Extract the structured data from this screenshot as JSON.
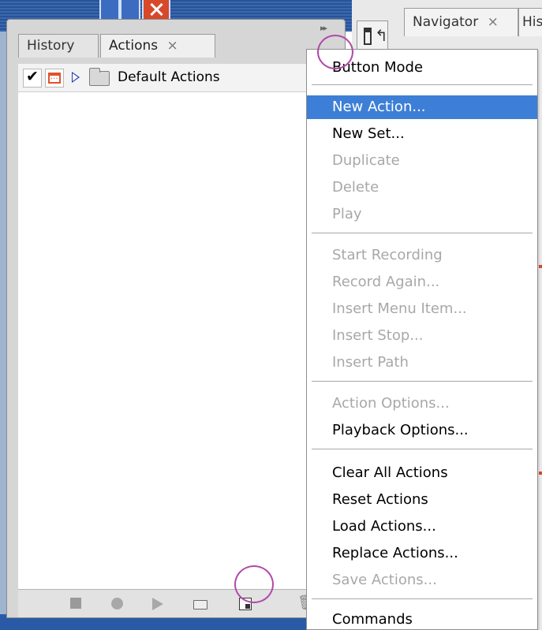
{
  "actions_panel": {
    "tabs": [
      {
        "label": "History"
      },
      {
        "label": "Actions",
        "close": "×"
      }
    ],
    "scroll_arrows": "▸▸",
    "row": {
      "label": "Default Actions"
    }
  },
  "right_dock": {
    "navigator_tab": {
      "label": "Navigator",
      "close": "×"
    },
    "history_tab": {
      "label": "His"
    }
  },
  "menu": {
    "items": [
      {
        "label": "Button Mode",
        "state": "normal"
      },
      {
        "label": "New Action...",
        "state": "selected"
      },
      {
        "label": "New Set...",
        "state": "normal"
      },
      {
        "label": "Duplicate",
        "state": "disabled"
      },
      {
        "label": "Delete",
        "state": "disabled"
      },
      {
        "label": "Play",
        "state": "disabled"
      },
      {
        "label": "Start Recording",
        "state": "disabled"
      },
      {
        "label": "Record Again...",
        "state": "disabled"
      },
      {
        "label": "Insert Menu Item...",
        "state": "disabled"
      },
      {
        "label": "Insert Stop...",
        "state": "disabled"
      },
      {
        "label": "Insert Path",
        "state": "disabled"
      },
      {
        "label": "Action Options...",
        "state": "disabled"
      },
      {
        "label": "Playback Options...",
        "state": "normal"
      },
      {
        "label": "Clear All Actions",
        "state": "normal"
      },
      {
        "label": "Reset Actions",
        "state": "normal"
      },
      {
        "label": "Load Actions...",
        "state": "normal"
      },
      {
        "label": "Replace Actions...",
        "state": "normal"
      },
      {
        "label": "Save Actions...",
        "state": "disabled"
      },
      {
        "label": "Commands",
        "state": "normal"
      }
    ]
  },
  "colors": {
    "selection": "#3d7fd6",
    "highlight_circle": "#b04aa8",
    "disabled_text": "#a8a8a8"
  }
}
